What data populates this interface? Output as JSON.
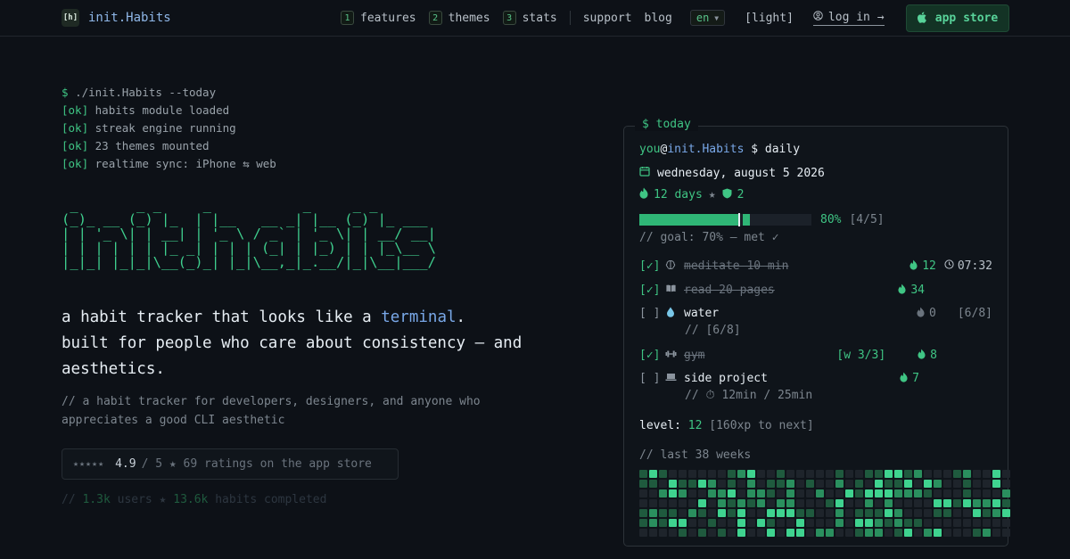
{
  "nav": {
    "logo_mark": "[h]",
    "brand": "init.Habits",
    "links": [
      {
        "num": "1",
        "label": "features"
      },
      {
        "num": "2",
        "label": "themes"
      },
      {
        "num": "3",
        "label": "stats"
      }
    ],
    "support": "support",
    "blog": "blog",
    "lang": "en",
    "theme": "[light]",
    "login": "log in →",
    "store": "app store"
  },
  "boot": {
    "prompt": "$",
    "command": "./init.Habits --today",
    "lines": [
      {
        "tag": "[ok]",
        "text": "habits module loaded"
      },
      {
        "tag": "[ok]",
        "text": "streak engine running"
      },
      {
        "tag": "[ok]",
        "text": "23 themes mounted"
      },
      {
        "tag": "[ok]",
        "text": "realtime sync: iPhone ⇆ web"
      }
    ]
  },
  "ascii_logo": " _       _ _     _           _     _ _\n(_)_ __ (_) |_  | |__   __ _| |__ (_) |_ ___\n| | '_ \\| | __| | '_ \\ / _` | '_ \\| | __/ __|\n| | | | | | |_ _| | | | (_| | |_) | | |_\\__ \\\n|_|_| |_|_|\\__(_)_| |_|\\__,_|_.__/|_|\\__|___/",
  "hero": {
    "line1_pre": "a habit tracker that looks like a ",
    "line1_hl": "terminal",
    "line1_post": ".",
    "line2": "built for people who care about consistency — and aesthetics.",
    "sub": "// a habit tracker for developers, designers, and anyone who appreciates a good CLI aesthetic",
    "stars": "★★★★★",
    "score": "4.9",
    "rating_rest": "/ 5 ★ 69 ratings on the app store",
    "stats_pre": "//",
    "users": "1.3k",
    "users_label": "users ★",
    "habits": "13.6k",
    "habits_label": "habits completed"
  },
  "panel": {
    "title": "$ today",
    "user": "you",
    "at": "@",
    "host": "init.Habits",
    "cmd": " $ daily",
    "date": "wednesday, august 5 2026",
    "streak_days": "12 days",
    "streak_sep": "★",
    "shields": "2",
    "progress": 0.8,
    "progress_goal": 0.7,
    "progress_pct": "80%",
    "progress_count": "[4/5]",
    "goal": "// goal: 70% — met ✓",
    "tasks": [
      {
        "check": "[✓]",
        "name": "meditate 10 min",
        "streak": "12",
        "time": "07:32"
      },
      {
        "check": "[✓]",
        "name": "read 20 pages",
        "streak": "34"
      },
      {
        "check": "[ ]",
        "name": "water",
        "streak": "0",
        "count": "[6/8]",
        "note": "// [6/8]"
      },
      {
        "check": "[✓]",
        "name": "gym",
        "weekly": "[w 3/3]",
        "streak": "8"
      },
      {
        "check": "[ ]",
        "name": "side project",
        "streak": "7",
        "note": "// ⏱ 12min / 25min"
      }
    ],
    "level_label": "level:",
    "level": "12",
    "level_next": "[160xp to next]",
    "weeks": "// last 38 weeks"
  },
  "colors": {
    "accent": "#3fc584",
    "bg": "#0d1117",
    "heat": [
      "#1e242b",
      "#1f5a3e",
      "#2a8f5e",
      "#3fd38f"
    ]
  }
}
